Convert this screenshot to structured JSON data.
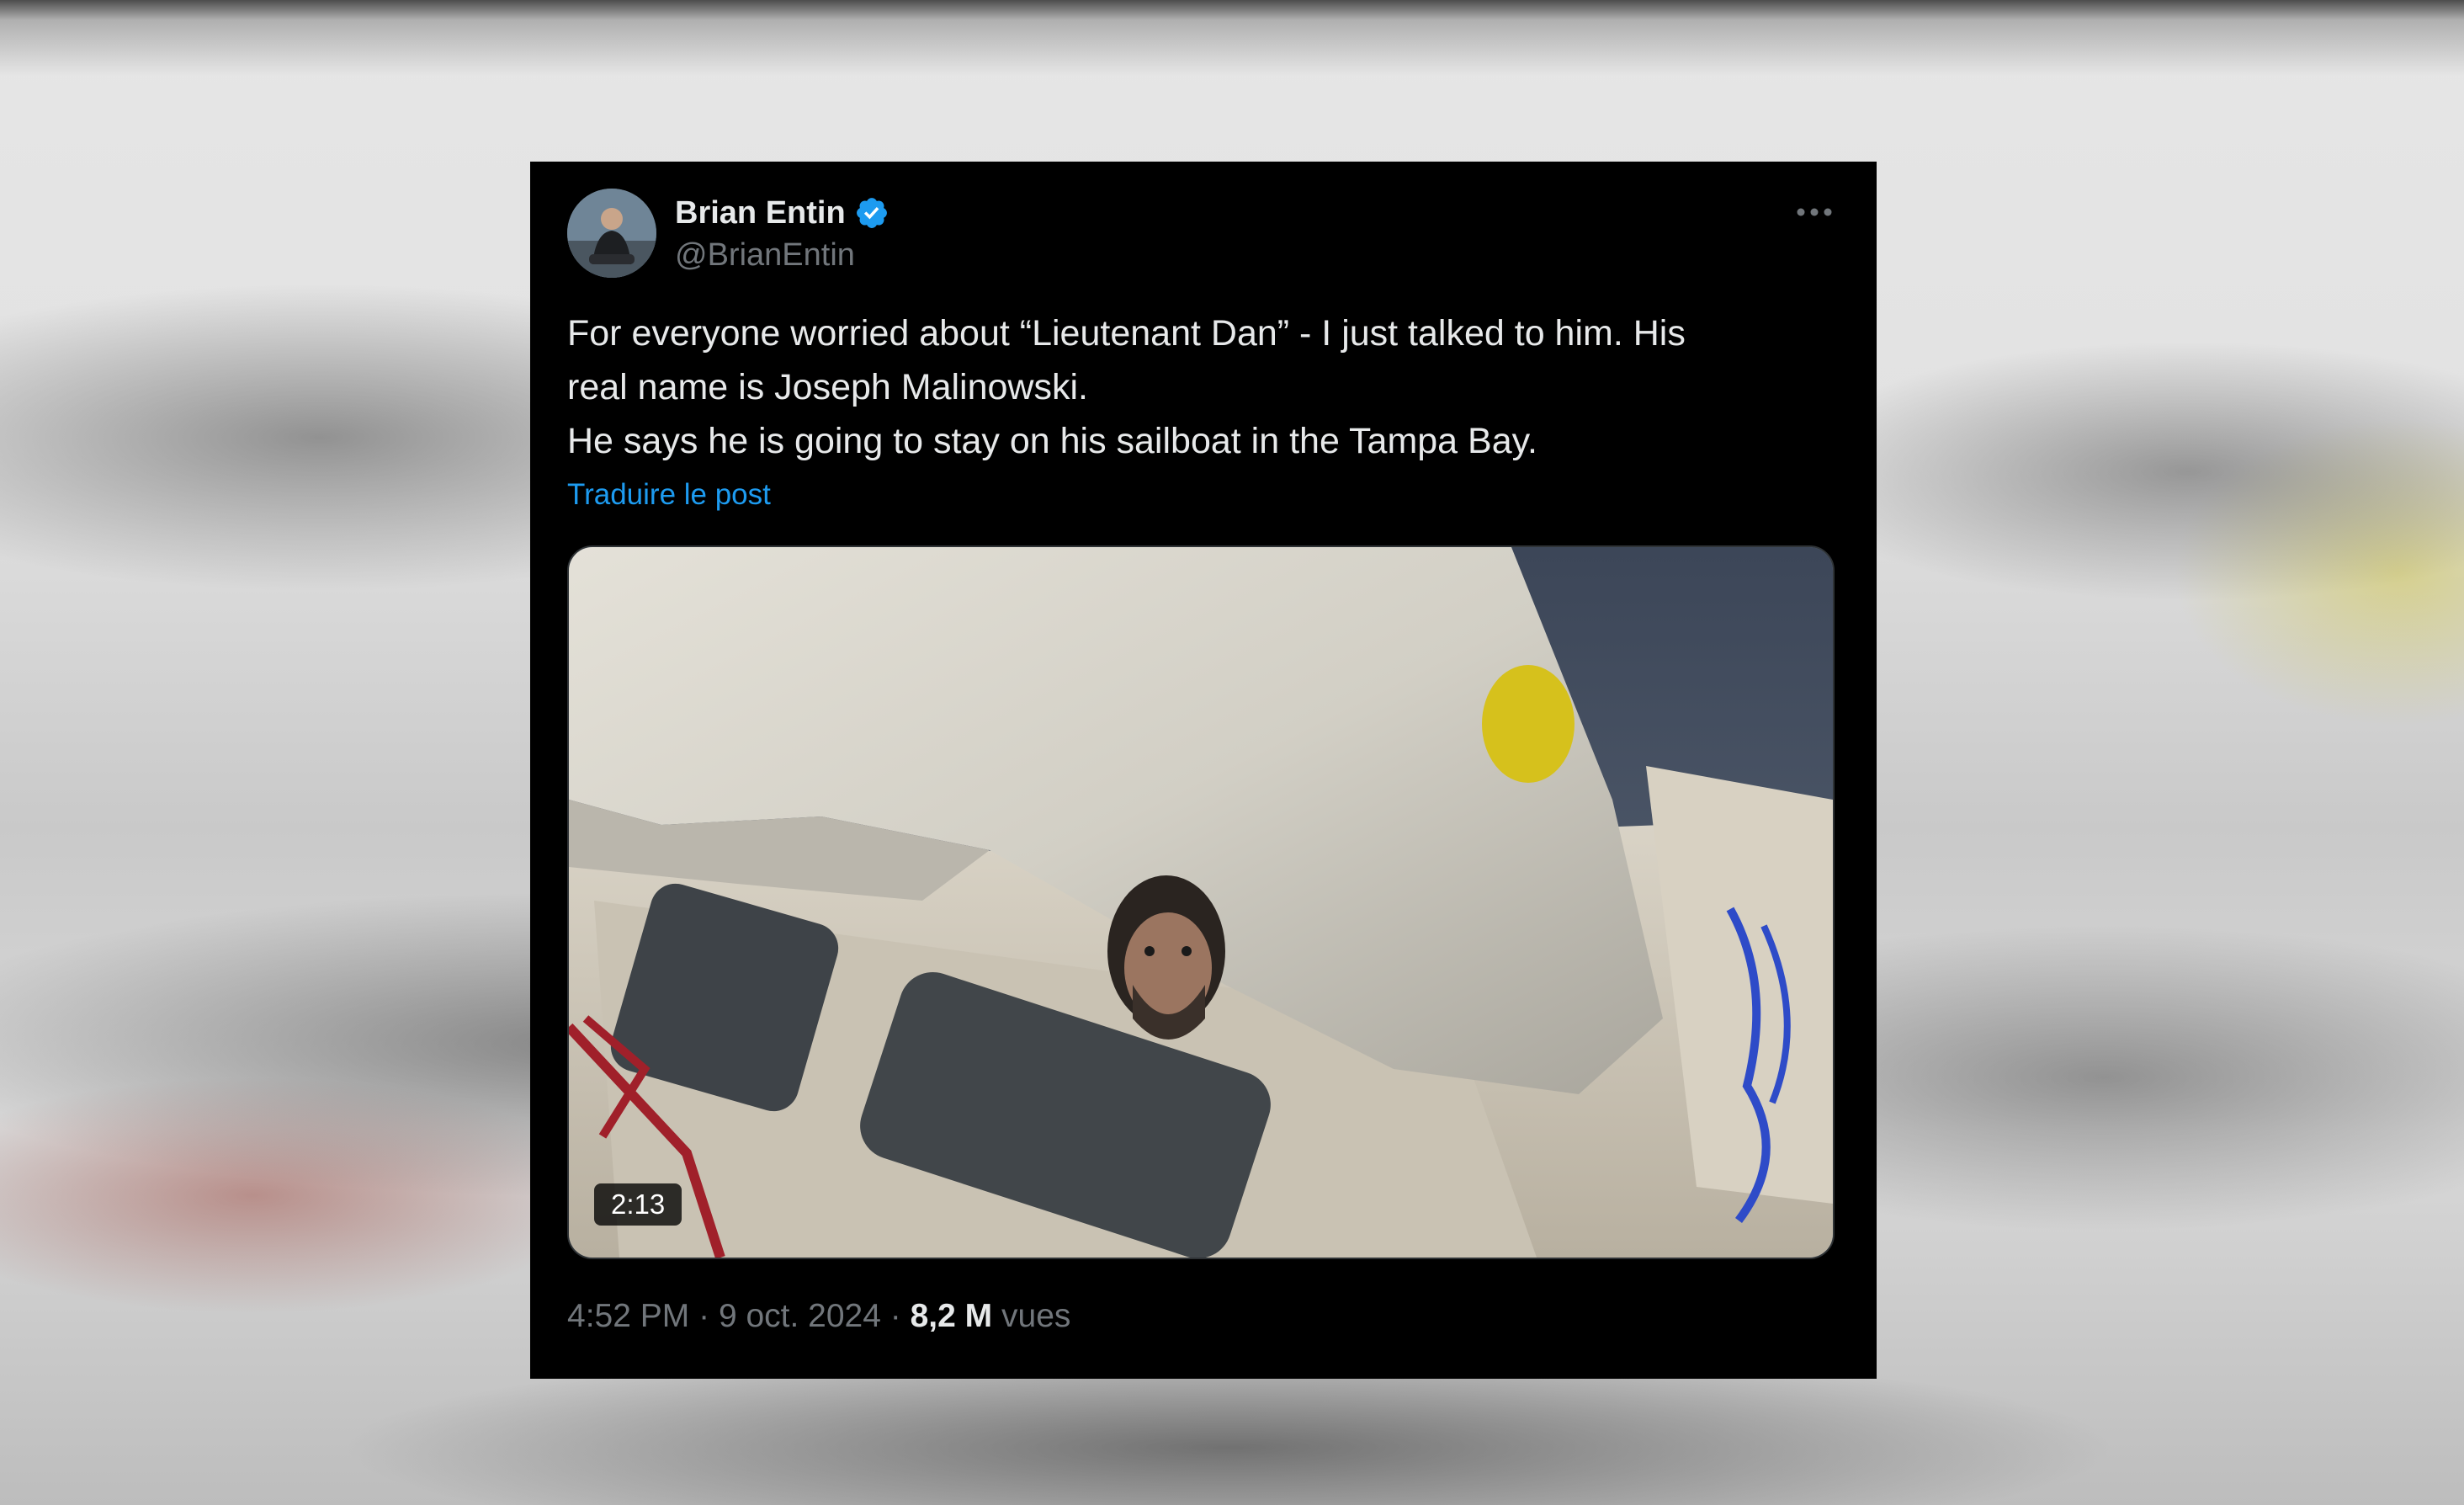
{
  "tweet": {
    "author": {
      "name": "Brian Entin",
      "handle": "@BrianEntin",
      "verified": true
    },
    "text_lines": [
      "For everyone worried about “Lieutenant Dan” - I just talked to him. His",
      "real name is Joseph Malinowski.",
      "He says he is going to stay on his sailboat in the Tampa Bay."
    ],
    "translate_label": "Traduire le post",
    "video": {
      "duration": "2:13"
    },
    "meta": {
      "time": "4:52 PM",
      "separator": "·",
      "date": "9 oct. 2024",
      "views_count": "8,2 M",
      "views_label": "vues"
    }
  },
  "colors": {
    "background_card": "#000000",
    "text_primary": "#e7e9ea",
    "text_secondary": "#71767b",
    "link": "#1d9bf0",
    "verified_badge": "#1d9bf0"
  },
  "icons": {
    "verified": "verified-badge-icon",
    "more": "more-options-icon"
  }
}
